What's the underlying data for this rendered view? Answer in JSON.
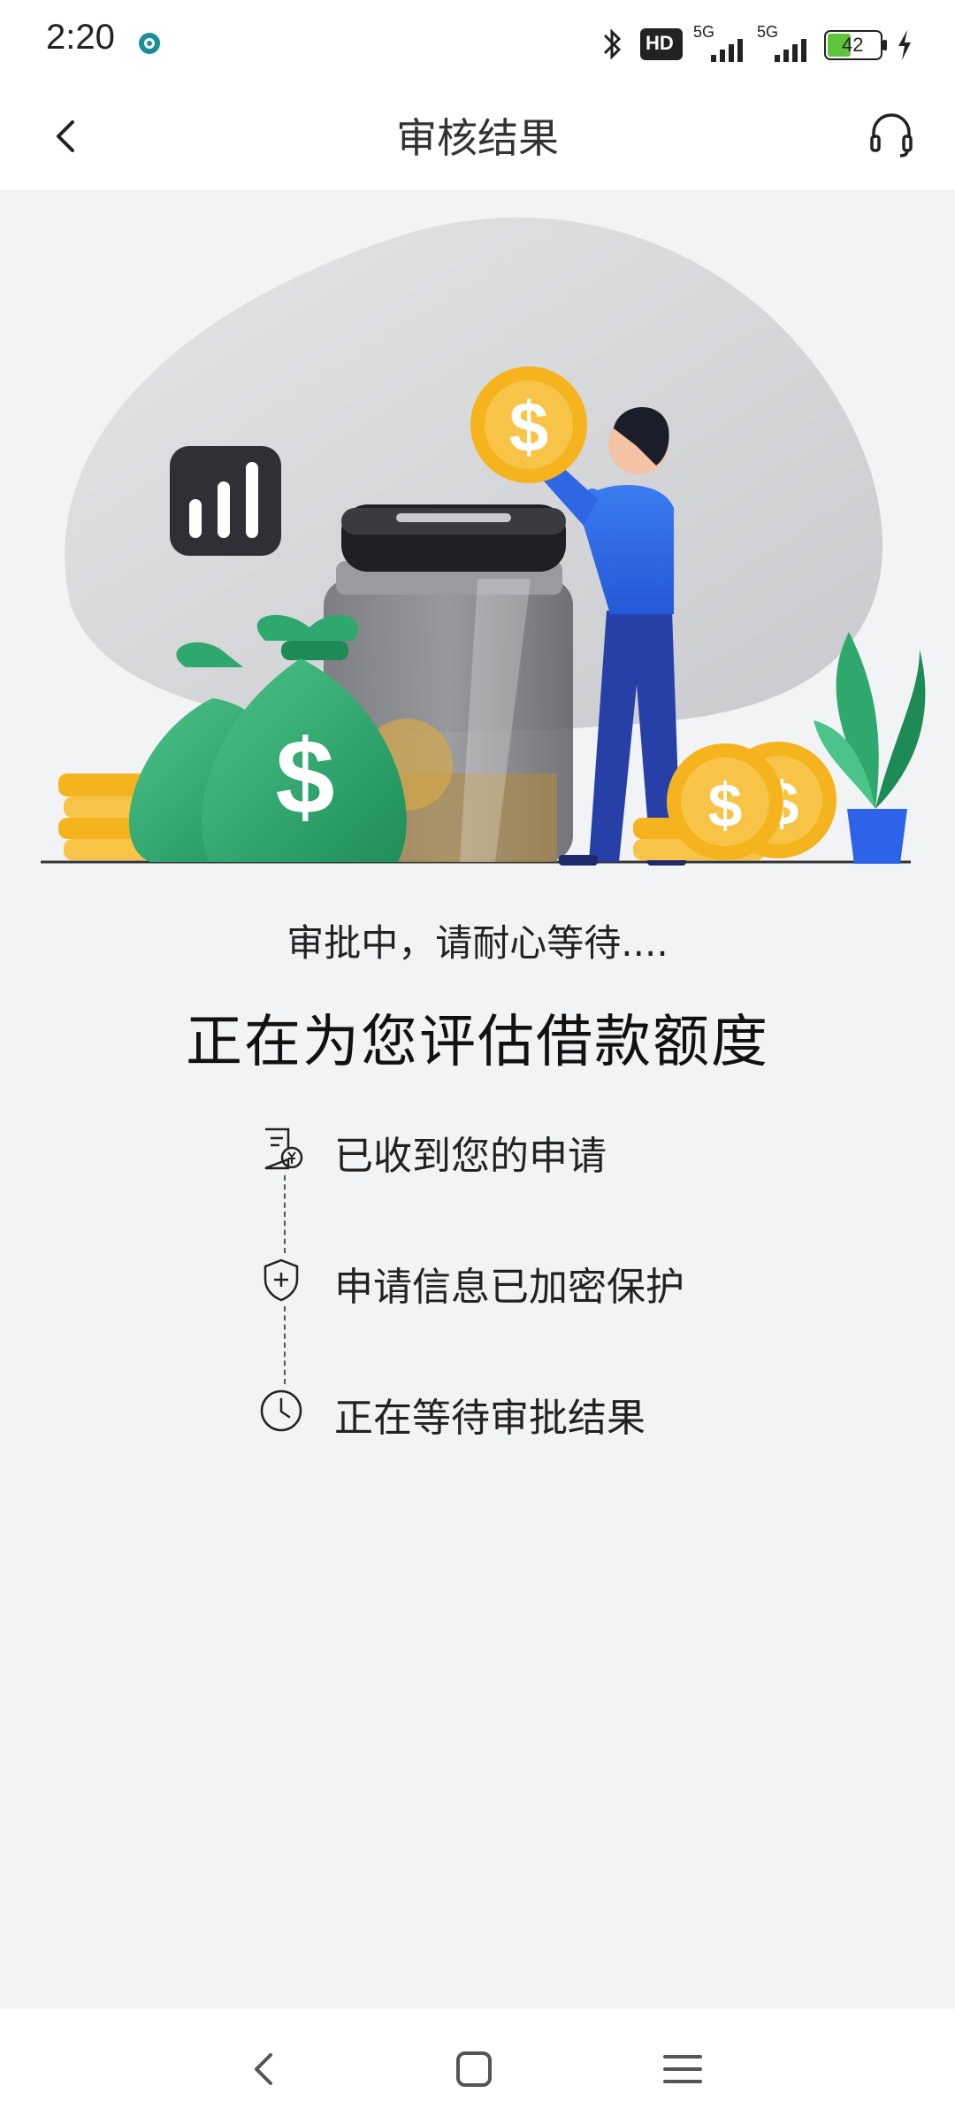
{
  "status_bar": {
    "time": "2:20",
    "icons": [
      "app-notification-icon",
      "bluetooth-icon",
      "hd-icon",
      "signal-5g-icon",
      "signal-5g-icon",
      "battery-icon",
      "charging-icon"
    ],
    "hd_label": "HD",
    "network_label_1": "5G",
    "network_label_2": "5G",
    "battery_level": "42",
    "battery_color": "#5ec43a"
  },
  "header": {
    "title": "审核结果",
    "back_icon": "chevron-left-icon",
    "service_icon": "headset-icon"
  },
  "content": {
    "subtitle": "审批中，请耐心等待....",
    "title": "正在为您评估借款额度",
    "steps": [
      {
        "label": "已收到您的申请",
        "icon": "document-money-icon"
      },
      {
        "label": "申请信息已加密保护",
        "icon": "shield-plus-icon"
      },
      {
        "label": "正在等待审批结果",
        "icon": "clock-icon"
      }
    ]
  },
  "colors": {
    "accent_green": "#27a36a",
    "coin_gold": "#f5b41e",
    "figure_blue": "#2d63e8"
  },
  "nav_bar": {
    "items": [
      "back-icon",
      "home-icon",
      "menu-icon"
    ]
  }
}
